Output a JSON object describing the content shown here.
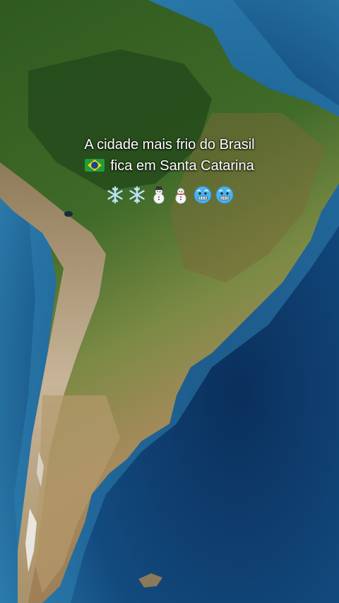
{
  "caption": {
    "line1": "A cidade mais frio do Brasil",
    "line2": "fica em Santa Catarina"
  },
  "emojis": [
    {
      "icon": "snowflake-icon"
    },
    {
      "icon": "snowflake-icon"
    },
    {
      "icon": "snowman-icon"
    },
    {
      "icon": "snowman-icon"
    },
    {
      "icon": "cold-face-icon"
    },
    {
      "icon": "cold-face-icon"
    }
  ],
  "flag": {
    "icon": "brazil-flag-icon"
  },
  "colors": {
    "ocean_deep": "#0b3d6e",
    "ocean_shallow": "#2f7fae",
    "forest": "#2f5a1f",
    "grassland": "#6f8a3a",
    "desert": "#b08a5a",
    "andes": "#c8b498",
    "snow": "#f2f2f2"
  }
}
